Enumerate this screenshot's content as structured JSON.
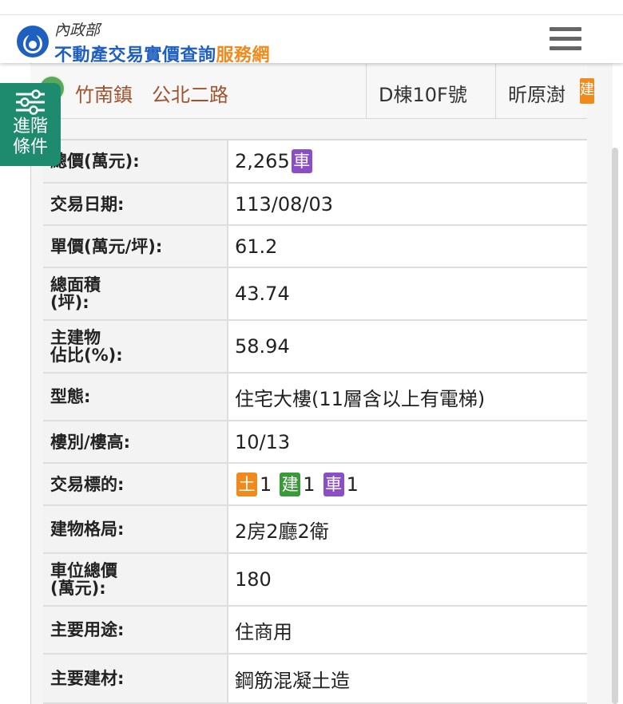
{
  "header": {
    "ministry": "內政部",
    "site_title_main": "不動產交易實價查詢",
    "site_title_accent": "服務網"
  },
  "address_bar": {
    "location": "竹南鎮　公北二路",
    "unit": "D棟10F號",
    "name": "昕原澍",
    "badge": "建"
  },
  "advanced_filter": {
    "label": "進階條件"
  },
  "details": [
    {
      "key": "總價(萬元):",
      "value": "2,265",
      "badge": "車"
    },
    {
      "key": "交易日期:",
      "value": "113/08/03"
    },
    {
      "key": "單價(萬元/坪):",
      "value": "61.2"
    },
    {
      "key": "總面積\n(坪):",
      "value": "43.74"
    },
    {
      "key": "主建物\n佔比(%):",
      "value": "58.94"
    },
    {
      "key": "型態:",
      "value": "住宅大樓(11層含以上有電梯)"
    },
    {
      "key": "樓別/樓高:",
      "value": "10/13"
    },
    {
      "key": "交易標的:",
      "targets": [
        {
          "badge": "土",
          "count": "1"
        },
        {
          "badge": "建",
          "count": "1"
        },
        {
          "badge": "車",
          "count": "1"
        }
      ]
    },
    {
      "key": "建物格局:",
      "value": "2房2廳2衛"
    },
    {
      "key": "車位總價\n(萬元):",
      "value": "180"
    },
    {
      "key": "主要用途:",
      "value": "住商用"
    },
    {
      "key": "主要建材:",
      "value": "鋼筋混凝土造"
    }
  ],
  "colors": {
    "brand_blue": "#1f5fbf",
    "brand_orange": "#f08a1c",
    "location_text": "#a0522d",
    "filter_green": "#1e8a6e",
    "badge_car": "#8c4ec7",
    "badge_land": "#f08a1c",
    "badge_building": "#3a9a3a"
  },
  "icons": {
    "logo": "ministry-logo-icon",
    "menu": "hamburger-menu-icon",
    "filter": "sliders-icon",
    "location": "location-dot-icon"
  }
}
